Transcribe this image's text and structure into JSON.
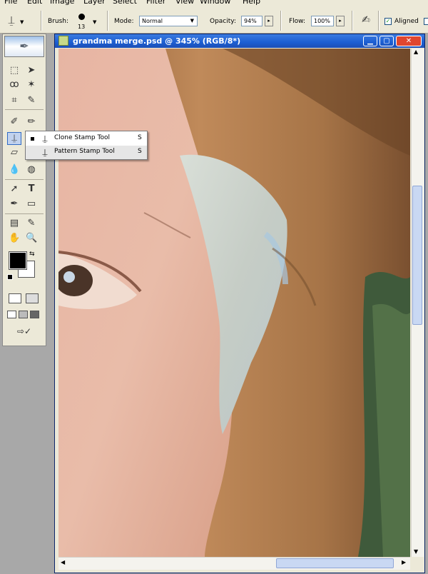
{
  "menubar": {
    "items": [
      "File",
      "Edit",
      "Image",
      "Layer",
      "Select",
      "Filter",
      "View",
      "Window",
      "Help"
    ]
  },
  "options": {
    "brush_label": "Brush:",
    "brush_size": "13",
    "mode_label": "Mode:",
    "mode_value": "Normal",
    "opacity_label": "Opacity:",
    "opacity_value": "94%",
    "flow_label": "Flow:",
    "flow_value": "100%",
    "aligned_label": "Aligned",
    "aligned_checked": true
  },
  "document": {
    "title": "grandma merge.psd @ 345% (RGB/8*)"
  },
  "tool_menu": {
    "items": [
      {
        "label": "Clone Stamp Tool",
        "shortcut": "S",
        "selected": true
      },
      {
        "label": "Pattern Stamp Tool",
        "shortcut": "S",
        "selected": false
      }
    ]
  },
  "colors": {
    "foreground": "#000000",
    "background": "#ffffff",
    "titlebar": "#1c5ed2",
    "close_button": "#e0462f"
  }
}
